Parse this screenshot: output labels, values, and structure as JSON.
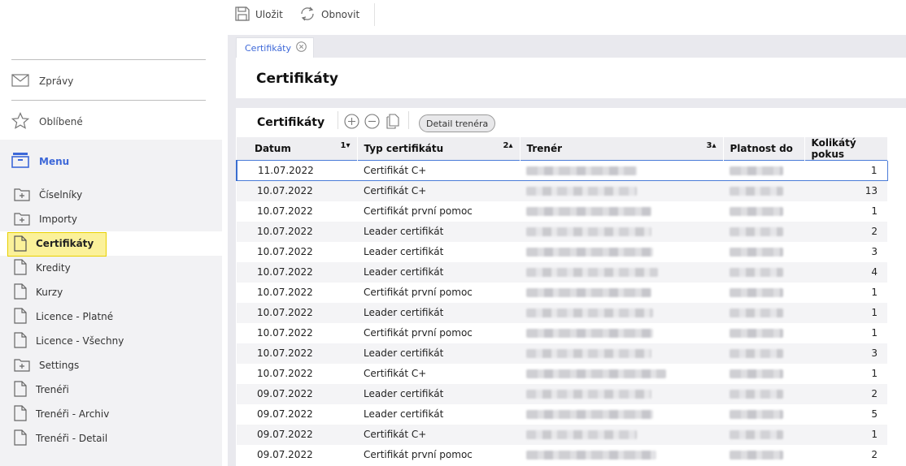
{
  "toolbar": {
    "save_label": "Uložit",
    "reload_label": "Obnovit"
  },
  "sidebar": {
    "messages_label": "Zprávy",
    "favorites_label": "Oblíbené",
    "menu_label": "Menu",
    "items": [
      {
        "label": "Číselníky",
        "icon": "folder-plus-icon"
      },
      {
        "label": "Importy",
        "icon": "folder-plus-icon"
      },
      {
        "label": "Certifikáty",
        "icon": "document-icon",
        "active": true
      },
      {
        "label": "Kredity",
        "icon": "document-icon"
      },
      {
        "label": "Kurzy",
        "icon": "document-icon"
      },
      {
        "label": "Licence - Platné",
        "icon": "document-icon"
      },
      {
        "label": "Licence - Všechny",
        "icon": "document-icon"
      },
      {
        "label": "Settings",
        "icon": "folder-plus-icon"
      },
      {
        "label": "Trenéři",
        "icon": "document-icon"
      },
      {
        "label": "Trenéři - Archiv",
        "icon": "document-icon"
      },
      {
        "label": "Trenéři - Detail",
        "icon": "document-icon"
      }
    ]
  },
  "tab": {
    "label": "Certifikáty"
  },
  "page": {
    "title": "Certifikáty"
  },
  "panel": {
    "title": "Certifikáty",
    "detail_button": "Detail trenéra"
  },
  "table": {
    "columns": [
      {
        "label": "Datum",
        "sort": "1▾"
      },
      {
        "label": "Typ certifikátu",
        "sort": "2▴"
      },
      {
        "label": "Trenér",
        "sort": "3▴"
      },
      {
        "label": "Platnost do",
        "sort": ""
      },
      {
        "label": "Kolikátý pokus",
        "sort": ""
      }
    ],
    "rows": [
      {
        "date": "11.07.2022",
        "type": "Certifikát C+",
        "attempt": "1"
      },
      {
        "date": "10.07.2022",
        "type": "Certifikát C+",
        "attempt": "13"
      },
      {
        "date": "10.07.2022",
        "type": "Certifikát první pomoc",
        "attempt": "1"
      },
      {
        "date": "10.07.2022",
        "type": "Leader certifikát",
        "attempt": "2"
      },
      {
        "date": "10.07.2022",
        "type": "Leader certifikát",
        "attempt": "3"
      },
      {
        "date": "10.07.2022",
        "type": "Leader certifikát",
        "attempt": "4"
      },
      {
        "date": "10.07.2022",
        "type": "Certifikát první pomoc",
        "attempt": "1"
      },
      {
        "date": "10.07.2022",
        "type": "Leader certifikát",
        "attempt": "1"
      },
      {
        "date": "10.07.2022",
        "type": "Certifikát první pomoc",
        "attempt": "1"
      },
      {
        "date": "10.07.2022",
        "type": "Leader certifikát",
        "attempt": "3"
      },
      {
        "date": "10.07.2022",
        "type": "Certifikát C+",
        "attempt": "1"
      },
      {
        "date": "09.07.2022",
        "type": "Leader certifikát",
        "attempt": "2"
      },
      {
        "date": "09.07.2022",
        "type": "Leader certifikát",
        "attempt": "5"
      },
      {
        "date": "09.07.2022",
        "type": "Certifikát C+",
        "attempt": "1"
      },
      {
        "date": "09.07.2022",
        "type": "Certifikát první pomoc",
        "attempt": "2"
      }
    ]
  },
  "colors": {
    "accent": "#3d68d8",
    "highlight": "#fbf19a",
    "highlight_border": "#e8d000",
    "selection": "#4a7bd8"
  }
}
